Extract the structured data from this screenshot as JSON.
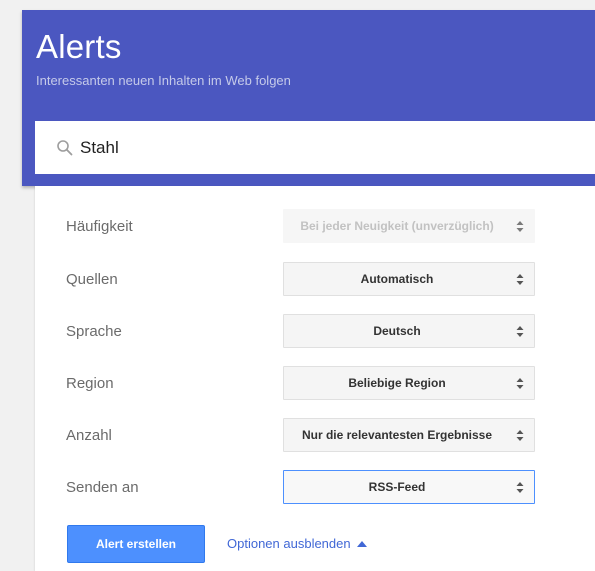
{
  "header": {
    "title": "Alerts",
    "subtitle": "Interessanten neuen Inhalten im Web folgen"
  },
  "search": {
    "value": "Stahl",
    "icon": "search-icon"
  },
  "options": [
    {
      "label": "Häufigkeit",
      "value": "Bei jeder Neuigkeit (unverzüglich)",
      "state": "disabled"
    },
    {
      "label": "Quellen",
      "value": "Automatisch",
      "state": "normal"
    },
    {
      "label": "Sprache",
      "value": "Deutsch",
      "state": "normal"
    },
    {
      "label": "Region",
      "value": "Beliebige Region",
      "state": "normal"
    },
    {
      "label": "Anzahl",
      "value": "Nur die relevantesten Ergebnisse",
      "state": "normal"
    },
    {
      "label": "Senden an",
      "value": "RSS-Feed",
      "state": "focused"
    }
  ],
  "actions": {
    "create_label": "Alert erstellen",
    "hide_options_label": "Optionen ausblenden"
  },
  "colors": {
    "header_bg": "#4b57c0",
    "primary_button": "#4d90fe",
    "link": "#4168d6"
  }
}
